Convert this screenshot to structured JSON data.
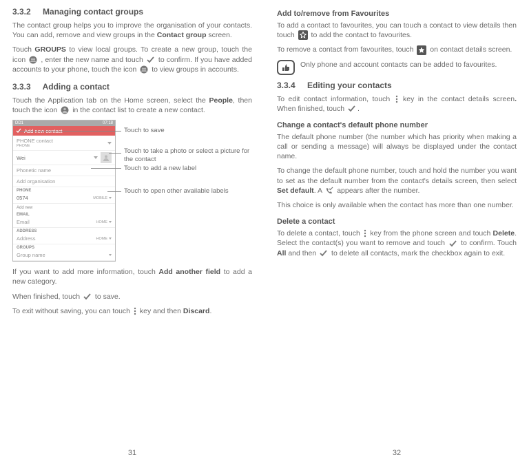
{
  "left": {
    "h332_num": "3.3.2",
    "h332_title": "Managing contact groups",
    "p1a": "The contact group helps you to improve the organisation of your contacts. You can add, remove and view groups in the ",
    "p1b": "Contact group",
    "p1c": " screen.",
    "p2a": "Touch ",
    "p2b": "GROUPS",
    "p2c": " to view local groups. To create a new group, touch the icon ",
    "p2d": " , enter the new name and touch ",
    "p2e": " to confirm. If you have added accounts to your phone, touch the icon ",
    "p2f": " to view groups in accounts.",
    "h333_num": "3.3.3",
    "h333_title": "Adding a contact",
    "p3a": "Touch the Application tab on the Home screen, select the ",
    "p3b": "People",
    "p3c": ", then touch the icon ",
    "p3d": " in the contact list to create a new contact.",
    "annot1": "Touch to save",
    "annot2": "Touch to take a photo or select a picture for the contact",
    "annot3": "Touch to add a new label",
    "annot4": "Touch to open other available labels",
    "p4a": "If you want to add more information, touch ",
    "p4b": "Add another field",
    "p4c": " to add a new category.",
    "p5a": "When finished, touch ",
    "p5b": " to save.",
    "p6a": "To exit without saving, you can touch ",
    "p6b": " key and then ",
    "p6c": "Discard",
    "p6d": ".",
    "page": "31"
  },
  "phone": {
    "time": "07:18",
    "signal": "DD1",
    "header": "Add new contact",
    "account": "PHONE contact",
    "account_sub": "PHONE",
    "name": "Wei",
    "phonetic": "Phonetic name",
    "org": "Add organisation",
    "sec_phone": "PHONE",
    "num": "0574",
    "num_label": "MOBILE",
    "addnew": "Add new",
    "sec_email": "EMAIL",
    "email": "Email",
    "email_label": "HOME",
    "sec_addr": "ADDRESS",
    "addr": "Address",
    "addr_label": "HOME",
    "sec_groups": "GROUPS",
    "group": "Group name"
  },
  "right": {
    "h_fav": "Add to/remove from Favourites",
    "p1a": "To add a contact to favourites, you can touch a contact to view details then touch ",
    "p1b": " to add the contact to favourites.",
    "p2a": "To remove a contact from favourites, touch ",
    "p2b": " on contact details screen.",
    "note": "Only phone and account contacts can be added to favourites.",
    "h334_num": "3.3.4",
    "h334_title": "Editing your contacts",
    "p3a": "To edit contact information, touch ",
    "p3b": " key in the contact details screen",
    "p3c": ".",
    "p3d": " When finished, touch ",
    "p3e": ".",
    "h_change": "Change a contact's default phone number",
    "p4": "The default phone number (the number which has priority when making a call or sending a message) will always be displayed under the contact name.",
    "p5a": "To change the default phone number, touch and hold the number you want to set as the default number from the contact's details screen, then select ",
    "p5b": "Set default",
    "p5c": ". A ",
    "p5d": " appears after the number.",
    "p6": "This choice is only available when the contact has more than one number.",
    "h_del": "Delete a contact",
    "p7a": "To delete a contact, touch ",
    "p7b": " key from the phone screen and touch ",
    "p7c": "Delete",
    "p7d": ". Select the contact(s) you want to remove and touch ",
    "p7e": " to confirm. Touch ",
    "p7f": "All",
    "p7g": " and then ",
    "p7h": " to delete all contacts, mark the checkbox again to exit.",
    "page": "32"
  }
}
